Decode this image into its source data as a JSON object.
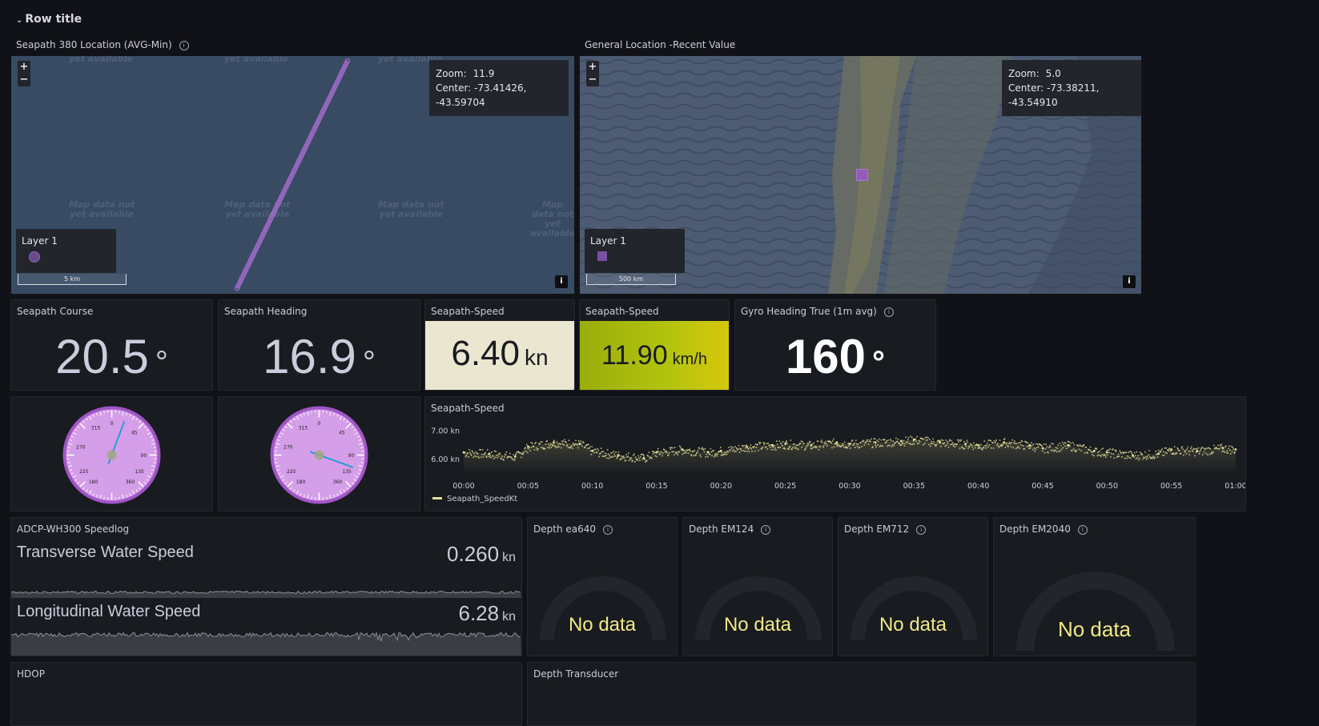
{
  "row": {
    "title": "Row title"
  },
  "map1": {
    "title": "Seapath 380 Location (AVG-Min)",
    "zoom_label": "Zoom:",
    "zoom_value": "11.9",
    "center_label": "Center:",
    "center_value": "-73.41426, -43.59704",
    "layer_label": "Layer 1",
    "scale_label": "5 km",
    "zoom_in": "+",
    "zoom_out": "−",
    "attribution": "i",
    "watermark_line1": "Map data not",
    "watermark_line2": "yet available",
    "marker_color": "#9b59c7",
    "background_color": "#384b63"
  },
  "map2": {
    "title": "General Location -Recent Value",
    "zoom_label": "Zoom:",
    "zoom_value": "5.0",
    "center_label": "Center:",
    "center_value": "-73.38211, -43.54910",
    "layer_label": "Layer 1",
    "scale_label": "500 km",
    "zoom_in": "+",
    "zoom_out": "−",
    "attribution": "i",
    "marker_color": "#9b59c7",
    "background_color": "#4a5a70"
  },
  "stats": [
    {
      "title": "Seapath Course",
      "value": "20.5",
      "unit": "°"
    },
    {
      "title": "Seapath Heading",
      "value": "16.9",
      "unit": "°"
    },
    {
      "title": "Seapath-Speed",
      "value": "6.40",
      "unit": "kn",
      "bg": "#eae6cf"
    },
    {
      "title": "Seapath-Speed",
      "value": "11.90",
      "unit": "km/h",
      "bg": "#b3c40e"
    },
    {
      "title": "Gyro Heading True (1m avg)",
      "value": "160",
      "unit": "°"
    }
  ],
  "compass": {
    "tick_labels": [
      "0",
      "45",
      "90",
      "135",
      "180",
      "225",
      "270",
      "315"
    ],
    "display_labels": [
      "0",
      "45",
      "90",
      "135",
      "360",
      "180",
      "225",
      "270",
      "315"
    ],
    "course_deg": 20.5,
    "heading_deg": 110,
    "face_color": "#d59ee8",
    "rim_color": "#a055c6",
    "needle_color": "#1a9bd7"
  },
  "speed_chart": {
    "title": "Seapath-Speed",
    "legend": "Seapath_SpeedKt",
    "line_color": "#e8e29a"
  },
  "chart_data": {
    "type": "scatter",
    "title": "Seapath-Speed",
    "xlabel": "",
    "ylabel": "",
    "x_ticks": [
      "00:00",
      "00:05",
      "00:10",
      "00:15",
      "00:20",
      "00:25",
      "00:30",
      "00:35",
      "00:40",
      "00:45",
      "00:50",
      "00:55",
      "01:00"
    ],
    "y_ticks": [
      "6.00 kn",
      "7.00 kn"
    ],
    "ylim": [
      5.6,
      7.3
    ],
    "series": [
      {
        "name": "Seapath_SpeedKt",
        "x": [
          "00:00",
          "00:02",
          "00:04",
          "00:05",
          "00:07",
          "00:09",
          "00:10",
          "00:12",
          "00:14",
          "00:15",
          "00:17",
          "00:19",
          "00:20",
          "00:22",
          "00:24",
          "00:25",
          "00:27",
          "00:29",
          "00:30",
          "00:32",
          "00:34",
          "00:35",
          "00:37",
          "00:39",
          "00:40",
          "00:42",
          "00:44",
          "00:45",
          "00:47",
          "00:49",
          "00:50",
          "00:52",
          "00:54",
          "00:55",
          "00:57",
          "00:59",
          "01:00"
        ],
        "values": [
          6.25,
          6.2,
          6.1,
          6.45,
          6.6,
          6.55,
          6.3,
          6.15,
          6.05,
          6.25,
          6.35,
          6.25,
          6.3,
          6.45,
          6.5,
          6.55,
          6.5,
          6.6,
          6.55,
          6.6,
          6.65,
          6.7,
          6.6,
          6.55,
          6.5,
          6.6,
          6.5,
          6.4,
          6.5,
          6.3,
          6.25,
          6.15,
          6.2,
          6.35,
          6.3,
          6.4,
          6.35
        ]
      }
    ],
    "legend": "bottom-left",
    "grid": false
  },
  "adcp": {
    "title": "ADCP-WH300 Speedlog",
    "rows": [
      {
        "label": "Transverse Water Speed",
        "value": "0.260",
        "unit": "kn"
      },
      {
        "label": "Longitudinal Water Speed",
        "value": "6.28",
        "unit": "kn"
      }
    ]
  },
  "depth_gauges": [
    {
      "title": "Depth ea640",
      "value": "No data"
    },
    {
      "title": "Depth EM124",
      "value": "No data"
    },
    {
      "title": "Depth EM712",
      "value": "No data"
    },
    {
      "title": "Depth EM2040",
      "value": "No data"
    }
  ],
  "bottom": {
    "hdop_title": "HDOP",
    "depth_transducer_title": "Depth Transducer"
  }
}
